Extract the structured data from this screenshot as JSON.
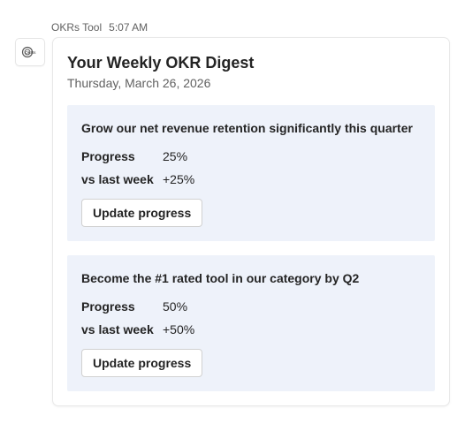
{
  "message": {
    "sender": "OKRs Tool",
    "time": "5:07 AM",
    "avatar_icon": "okrs-logo-icon",
    "avatar_text": "OKRs"
  },
  "card": {
    "title": "Your Weekly OKR Digest",
    "date": "Thursday, March 26, 2026",
    "objectives": [
      {
        "title": "Grow our net revenue retention significantly this quarter",
        "progress_label": "Progress",
        "progress_value": "25%",
        "change_label": "vs last week",
        "change_value": "+25%",
        "button_label": "Update progress"
      },
      {
        "title": "Become the #1 rated tool in our category by Q2",
        "progress_label": "Progress",
        "progress_value": "50%",
        "change_label": "vs last week",
        "change_value": "+50%",
        "button_label": "Update progress"
      }
    ]
  },
  "colors": {
    "card_background": "#ffffff",
    "objective_background": "#eef2fa",
    "secondary_text": "#616161",
    "primary_text": "#242424"
  }
}
